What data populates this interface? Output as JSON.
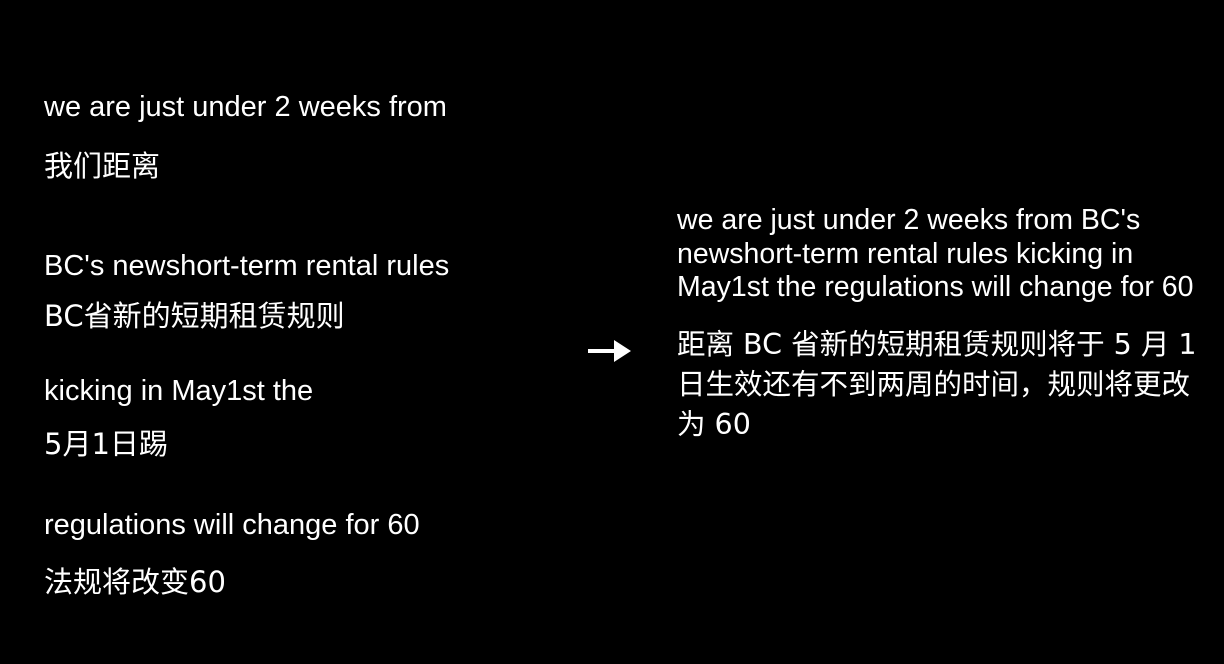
{
  "segments": [
    {
      "en": "we are just under 2 weeks from",
      "zh": "我们距离"
    },
    {
      "en": "BC's newshort-term rental rules",
      "zh": "BC省新的短期租赁规则"
    },
    {
      "en": "kicking in May1st the",
      "zh": "5月1日踢"
    },
    {
      "en": "regulations will change for 60",
      "zh": "法规将改变60"
    }
  ],
  "arrow_icon": "right-arrow-icon",
  "merged": {
    "en": "we are just under 2 weeks from BC's newshort-term rental rules kicking in May1st the regulations will change for 60",
    "zh": "距离 BC 省新的短期租赁规则将于 5 月 1 日生效还有不到两周的时间，规则将更改为 60"
  },
  "colors": {
    "background": "#000000",
    "text": "#ffffff"
  }
}
